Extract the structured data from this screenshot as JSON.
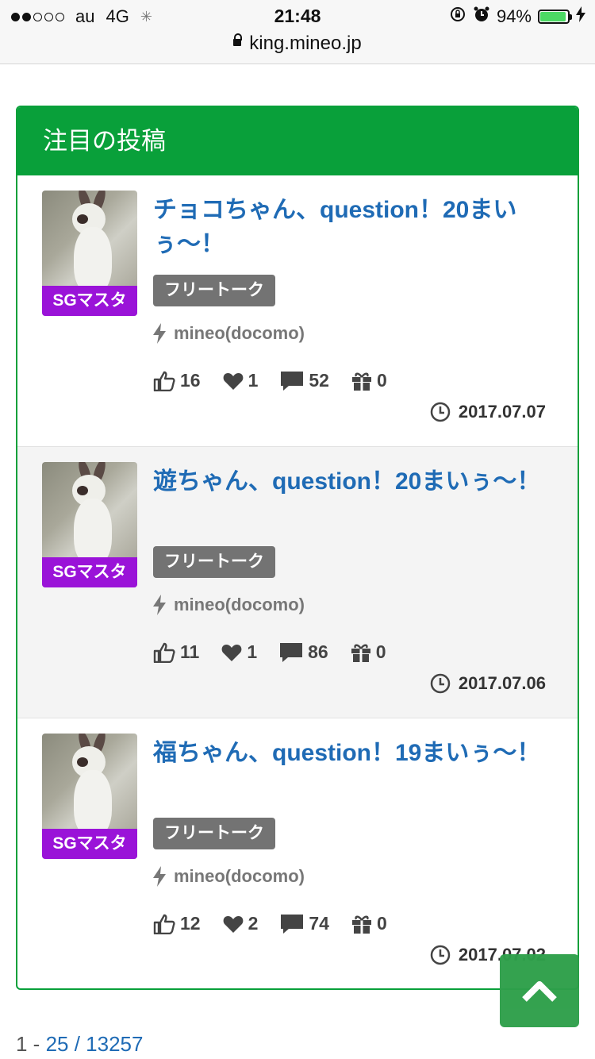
{
  "status_bar": {
    "carrier": "au",
    "network": "4G",
    "time": "21:48",
    "battery": "94%",
    "battery_level": 0.94
  },
  "url": "king.mineo.jp",
  "panel": {
    "title": "注目の投稿",
    "posts": [
      {
        "badge": "SGマスタ",
        "title": "チョコちゃん、question！20まいぅ〜！",
        "tag": "フリートーク",
        "carrier": "mineo(docomo)",
        "likes": "16",
        "hearts": "1",
        "comments": "52",
        "gifts": "0",
        "date": "2017.07.07"
      },
      {
        "badge": "SGマスタ",
        "title": "遊ちゃん、question！20まいぅ〜！",
        "tag": "フリートーク",
        "carrier": "mineo(docomo)",
        "likes": "11",
        "hearts": "1",
        "comments": "86",
        "gifts": "0",
        "date": "2017.07.06"
      },
      {
        "badge": "SGマスタ",
        "title": "福ちゃん、question！19まいぅ〜！",
        "tag": "フリートーク",
        "carrier": "mineo(docomo)",
        "likes": "12",
        "hearts": "2",
        "comments": "74",
        "gifts": "0",
        "date": "2017.07.02"
      }
    ]
  },
  "pager": {
    "prefix": "1 - ",
    "range_end": "25",
    "separator": " / ",
    "total": "13257"
  },
  "colors": {
    "panel_green": "#09a03a",
    "title_blue": "#1f6bb5",
    "badge_purple": "#9a13d8",
    "tag_gray": "#737373"
  }
}
